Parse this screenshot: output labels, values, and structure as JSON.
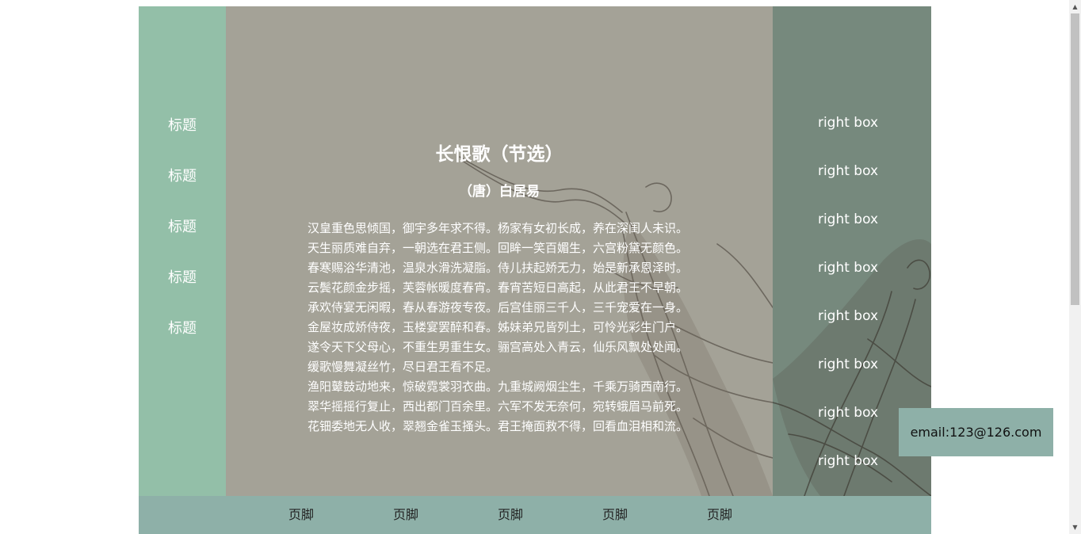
{
  "sidebar": {
    "items": [
      {
        "label": "标题"
      },
      {
        "label": "标题"
      },
      {
        "label": "标题"
      },
      {
        "label": "标题"
      },
      {
        "label": "标题"
      }
    ]
  },
  "poem": {
    "title": "长恨歌（节选）",
    "author": "（唐）白居易",
    "lines": [
      "汉皇重色思倾国，御宇多年求不得。杨家有女初长成，养在深闺人未识。",
      "天生丽质难自弃，一朝选在君王侧。回眸一笑百媚生，六宫粉黛无颜色。",
      "春寒赐浴华清池，温泉水滑洗凝脂。侍儿扶起娇无力，始是新承恩泽时。",
      "云鬓花颜金步摇，芙蓉帐暖度春宵。春宵苦短日高起，从此君王不早朝。",
      "承欢侍宴无闲暇，春从春游夜专夜。后宫佳丽三千人，三千宠爱在一身。",
      "金屋妆成娇侍夜，玉楼宴罢醉和春。姊妹弟兄皆列土，可怜光彩生门户。",
      "遂令天下父母心，不重生男重生女。骊宫高处入青云，仙乐风飘处处闻。",
      "缓歌慢舞凝丝竹，尽日君王看不足。",
      "渔阳鼙鼓动地来，惊破霓裳羽衣曲。九重城阙烟尘生，千乘万骑西南行。",
      "翠华摇摇行复止，西出都门百余里。六军不发无奈何，宛转蛾眉马前死。",
      "花钿委地无人收，翠翘金雀玉搔头。君王掩面救不得，回看血泪相和流。"
    ]
  },
  "right_panel": {
    "items": [
      {
        "label": "right box"
      },
      {
        "label": "right box"
      },
      {
        "label": "right box"
      },
      {
        "label": "right box"
      },
      {
        "label": "right box"
      },
      {
        "label": "right box"
      },
      {
        "label": "right box"
      },
      {
        "label": "right box"
      }
    ]
  },
  "footer": {
    "items": [
      {
        "label": "页脚"
      },
      {
        "label": "页脚"
      },
      {
        "label": "页脚"
      },
      {
        "label": "页脚"
      },
      {
        "label": "页脚"
      }
    ]
  },
  "contact": {
    "email": "email:123@126.com"
  },
  "colors": {
    "sidebar_bg": "#93bfa8",
    "content_bg": "#a4a297",
    "right_bg": "#76897d",
    "footer_bg": "#8eb0a8",
    "text_light": "#ffffff"
  }
}
